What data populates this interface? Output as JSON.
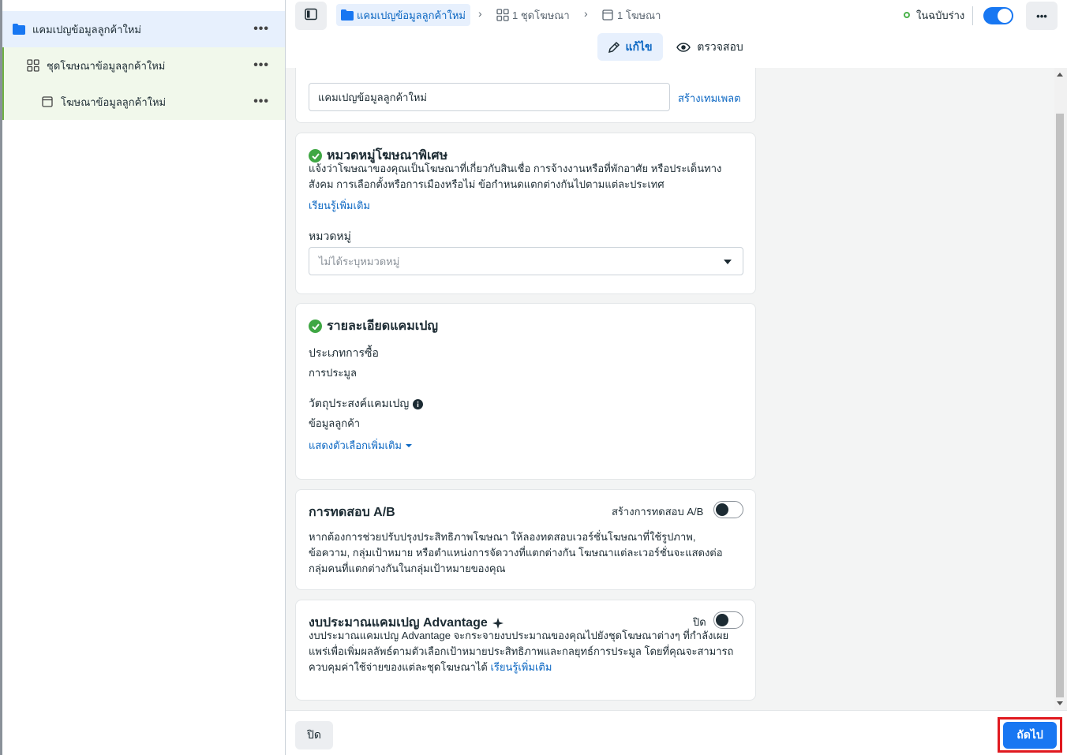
{
  "sidebar": {
    "items": [
      {
        "label": "แคมเปญข้อมูลลูกค้าใหม่",
        "icon": "folder-icon"
      },
      {
        "label": "ชุดโฆษณาข้อมูลลูกค้าใหม่",
        "icon": "grid-icon"
      },
      {
        "label": "โฆษณาข้อมูลลูกค้าใหม่",
        "icon": "ad-icon"
      }
    ],
    "more": "•••"
  },
  "topbar": {
    "breadcrumb": {
      "campaign": "แคมเปญข้อมูลลูกค้าใหม่",
      "adset": "1 ชุดโฆษณา",
      "ad": "1 โฆษณา"
    },
    "status": "ในฉบับร่าง",
    "more": "•••",
    "tabs": {
      "edit": "แก้ไข",
      "review": "ตรวจสอบ"
    }
  },
  "name_card": {
    "input_value": "แคมเปญข้อมูลลูกค้าใหม่",
    "create_template": "สร้างเทมเพลต"
  },
  "special_card": {
    "title": "หมวดหมู่โฆษณาพิเศษ",
    "desc_line1": "แจ้งว่าโฆษณาของคุณเป็นโฆษณาที่เกี่ยวกับสินเชื่อ การจ้างงานหรือที่พักอาศัย หรือประเด็นทาง",
    "desc_line2": "สังคม การเลือกตั้งหรือการเมืองหรือไม่ ข้อกำหนดแตกต่างกันไปตามแต่ละประเทศ",
    "learn_more": "เรียนรู้เพิ่มเติม",
    "category_label": "หมวดหมู่",
    "category_placeholder": "ไม่ได้ระบุหมวดหมู่"
  },
  "details_card": {
    "title": "รายละเอียดแคมเปญ",
    "buy_type_label": "ประเภทการซื้อ",
    "buy_type_value": "การประมูล",
    "objective_label": "วัตถุประสงค์แคมเปญ",
    "objective_value": "ข้อมูลลูกค้า",
    "more_options": "แสดงตัวเลือกเพิ่มเติม"
  },
  "ab_card": {
    "title": "การทดสอบ A/B",
    "toggle_label": "สร้างการทดสอบ A/B",
    "desc_line1": "หากต้องการช่วยปรับปรุงประสิทธิภาพโฆษณา ให้ลองทดสอบเวอร์ชั่นโฆษณาที่ใช้รูปภาพ,",
    "desc_line2": "ข้อความ, กลุ่มเป้าหมาย หรือตำแหน่งการจัดวางที่แตกต่างกัน โฆษณาแต่ละเวอร์ชั่นจะแสดงต่อ",
    "desc_line3": "กลุ่มคนที่แตกต่างกันในกลุ่มเป้าหมายของคุณ"
  },
  "budget_card": {
    "title": "งบประมาณแคมเปญ Advantage",
    "toggle_label": "ปิด",
    "desc_line1": "งบประมาณแคมเปญ Advantage จะกระจายงบประมาณของคุณไปยังชุดโฆษณาต่างๆ ที่กำลังเผย",
    "desc_line2": "แพร่เพื่อเพิ่มผลลัพธ์ตามตัวเลือกเป้าหมายประสิทธิภาพและกลยุทธ์การประมูล โดยที่คุณจะสามารถ",
    "desc_line3": "ควบคุมค่าใช้จ่ายของแต่ละชุดโฆษณาได้ ",
    "learn_more": "เรียนรู้เพิ่มเติม"
  },
  "footer": {
    "close": "ปิด",
    "next": "ถัดไป"
  },
  "colors": {
    "accent": "#1877f2",
    "link": "#0a66c2",
    "success": "#3fa744",
    "highlight": "#e0191f"
  }
}
